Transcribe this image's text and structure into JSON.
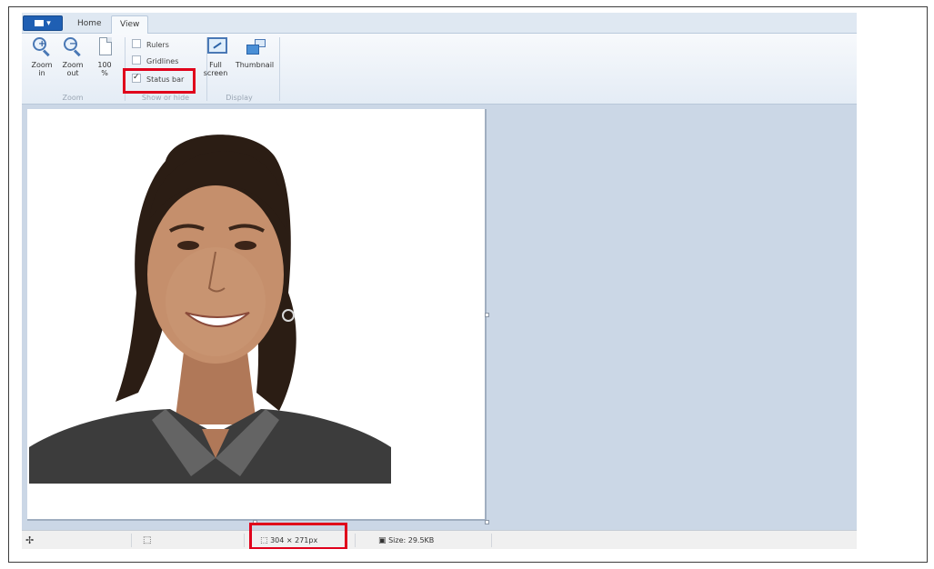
{
  "tabs": {
    "file_label": "",
    "home": "Home",
    "view": "View"
  },
  "ribbon": {
    "zoom_group": {
      "label": "Zoom",
      "zoom_in": [
        "Zoom",
        "in"
      ],
      "zoom_out": [
        "Zoom",
        "out"
      ],
      "hundred": [
        "100",
        "%"
      ]
    },
    "show_hide_group": {
      "label": "Show or hide",
      "rulers": {
        "label": "Rulers",
        "checked": false
      },
      "gridlines": {
        "label": "Gridlines",
        "checked": false
      },
      "status_bar": {
        "label": "Status bar",
        "checked": true
      }
    },
    "display_group": {
      "label": "Display",
      "full_screen": [
        "Full",
        "screen"
      ],
      "thumbnail": "Thumbnail"
    }
  },
  "status_bar": {
    "cursor_icon": "crosshair-move-icon",
    "selection_icon": "selection-size-icon",
    "dimensions": "304 × 271px",
    "size": "Size: 29.5KB"
  },
  "colors": {
    "accent": "#1f5fb3",
    "highlight": "#e0001b",
    "workspace": "#cbd7e6"
  }
}
